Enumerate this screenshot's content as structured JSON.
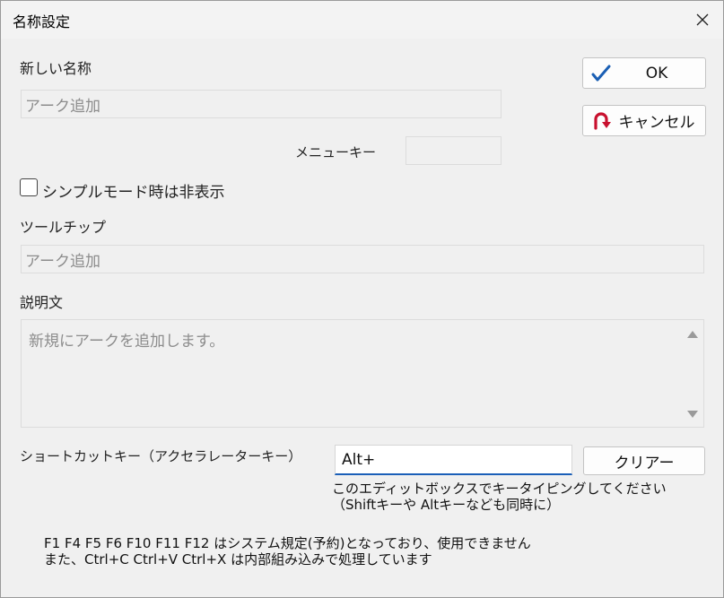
{
  "window": {
    "title": "名称設定"
  },
  "new_name": {
    "label": "新しい名称",
    "value": "アーク追加"
  },
  "buttons": {
    "ok": "OK",
    "cancel": "キャンセル",
    "clear": "クリアー"
  },
  "menu_key": {
    "label": "メニューキー",
    "value": ""
  },
  "simple_mode": {
    "label": "シンプルモード時は非表示",
    "checked": false
  },
  "tooltip": {
    "label": "ツールチップ",
    "value": "アーク追加"
  },
  "description": {
    "label": "説明文",
    "value": "新規にアークを追加します。"
  },
  "shortcut": {
    "label": "ショートカットキー（アクセラレーターキー）",
    "value": "Alt+",
    "hint_line1": "このエディットボックスでキータイピングしてください",
    "hint_line2": "（Shiftキーや Altキーなども同時に）"
  },
  "notes": {
    "line1": "F1 F4 F5 F6 F10 F11 F12 はシステム規定(予約)となっており、使用できません",
    "line2": "また、Ctrl+C  Ctrl+V   Ctrl+X は内部組み込みで処理しています"
  },
  "colors": {
    "ok_check": "#1a5fb4",
    "cancel_arrow": "#c8102e",
    "focus_underline": "#1b5fb8"
  },
  "icons": {
    "ok": "check-icon",
    "cancel": "undo-arrow-icon",
    "close": "close-icon"
  }
}
